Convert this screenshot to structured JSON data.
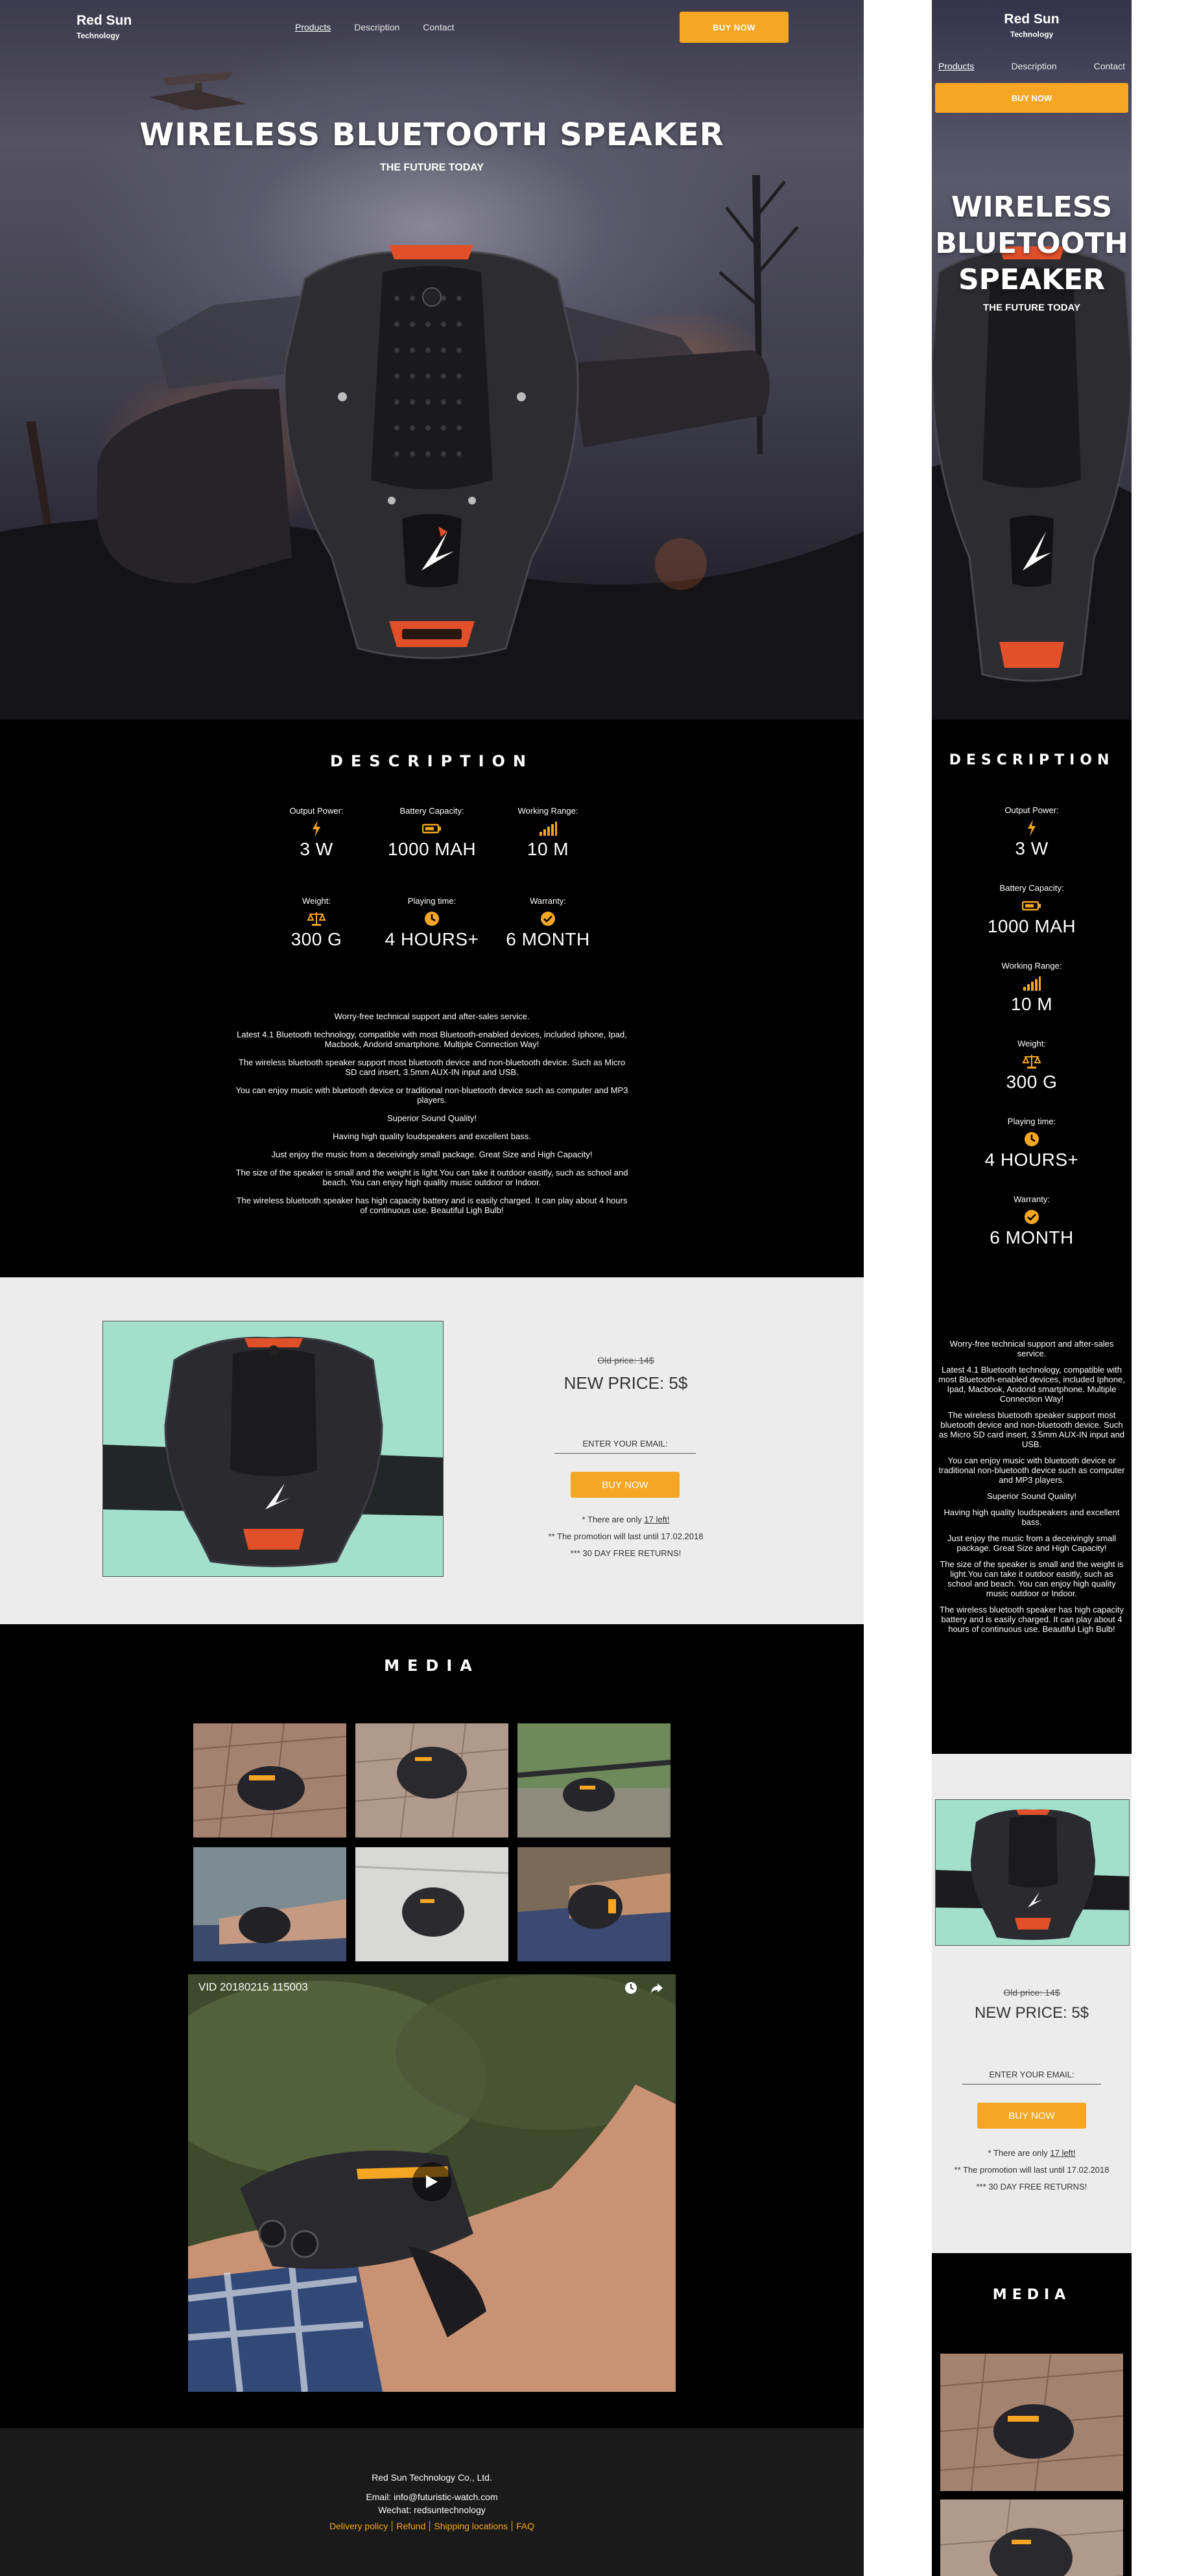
{
  "brand": {
    "name": "Red Sun",
    "sub": "Technology"
  },
  "nav": {
    "products": "Products",
    "description": "Description",
    "contact": "Contact"
  },
  "hero": {
    "buy_label": "BUY NOW",
    "title": "WIRELESS BLUETOOTH SPEAKER",
    "subtitle": "THE FUTURE TODAY"
  },
  "description": {
    "title": "DESCRIPTION",
    "specs": [
      {
        "label": "Output Power:",
        "value": "3 W",
        "icon": "bolt-icon"
      },
      {
        "label": "Battery Capacity:",
        "value": "1000 MAH",
        "icon": "battery-icon"
      },
      {
        "label": "Working Range:",
        "value": "10 M",
        "icon": "signal-icon"
      },
      {
        "label": "Weight:",
        "value": "300 G",
        "icon": "scale-icon"
      },
      {
        "label": "Playing time:",
        "value": "4 HOURS+",
        "icon": "clock-icon"
      },
      {
        "label": "Warranty:",
        "value": "6 MONTH",
        "icon": "check-circle-icon"
      }
    ],
    "paragraphs": [
      "Worry-free technical support and after-sales service.",
      "Latest 4.1 Bluetooth technology, compatible with most Bluetooth-enabled devices, included Iphone, Ipad, Macbook, Andorid smartphone. Multiple Connection Way!",
      "The wireless bluetooth speaker support most bluetooth device and non-bluetooth device. Such as Micro SD card insert, 3.5mm AUX-IN input and USB.",
      "You can enjoy music with bluetooth device or traditional non-bluetooth device such as computer and MP3 players.",
      "Superior Sound Quality!",
      "Having high quality loudspeakers and excellent bass.",
      "Just enjoy the music from a deceivingly small package. Great Size and High Capacity!",
      "The size of the speaker is small and the weight is light.You can take it outdoor easitly, such as school and beach. You can enjoy high quality music outdoor or Indoor.",
      "The wireless bluetooth speaker has high capacity battery and is easily charged. It can play about 4 hours of continuous use. Beautiful Ligh Bulb!"
    ]
  },
  "offer": {
    "old_price": "Old price: 14$",
    "new_price": "NEW PRICE: 5$",
    "email_placeholder": "ENTER YOUR EMAIL:",
    "button": "BUY NOW",
    "stock_prefix": "* There are only ",
    "stock_link": "17 left!",
    "promo": "** The promotion will last until 17.02.2018",
    "returns": "*** 30 DAY FREE RETURNS!"
  },
  "media": {
    "title": "MEDIA",
    "video_title": "VID 20180215 115003"
  },
  "footer": {
    "company": "Red Sun Technology Co., Ltd.",
    "email": "Email: info@futuristic-watch.com",
    "wechat": "Wechat: redsuntechnology",
    "links": [
      "Delivery policy",
      "Refund",
      "Shipping locations",
      "FAQ"
    ]
  },
  "colors": {
    "accent": "#f5a623",
    "dark": "#000000",
    "light_bg": "#ececec",
    "footer_bg": "#1a1a1a"
  }
}
